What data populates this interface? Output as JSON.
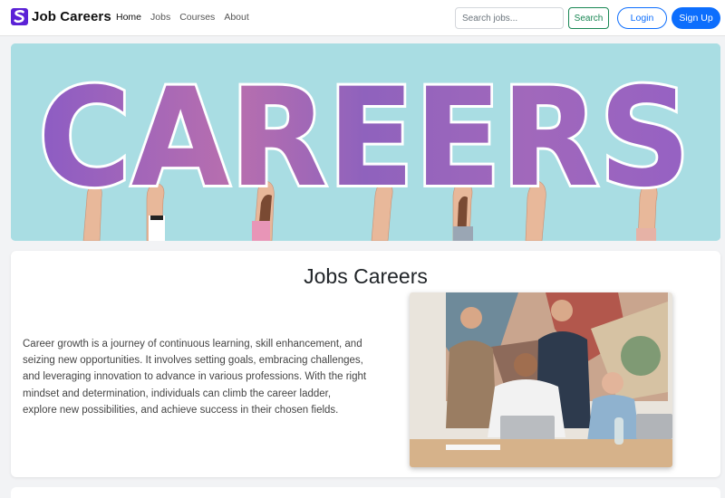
{
  "brand": {
    "logo_letter": "S",
    "name": "Job Careers"
  },
  "nav": {
    "items": [
      {
        "label": "Home",
        "active": true
      },
      {
        "label": "Jobs",
        "active": false
      },
      {
        "label": "Courses",
        "active": false
      },
      {
        "label": "About",
        "active": false
      }
    ]
  },
  "search": {
    "placeholder": "Search jobs...",
    "value": "",
    "button_label": "Search"
  },
  "auth": {
    "login_label": "Login",
    "signup_label": "Sign Up"
  },
  "hero": {
    "text": "CAREERS"
  },
  "section": {
    "title": "Jobs Careers",
    "body": "Career growth is a journey of continuous learning, skill enhancement, and seizing new opportunities. It involves setting goals, embracing challenges, and leveraging innovation to advance in various professions. With the right mindset and determination, individuals can climb the career ladder, explore new possibilities, and achieve success in their chosen fields."
  },
  "colors": {
    "brand_purple": "#5b21d6",
    "primary_blue": "#0d6efd",
    "success_green": "#198754",
    "hero_bg": "#a9dde3",
    "letter_purple": "#9b5fc0"
  }
}
